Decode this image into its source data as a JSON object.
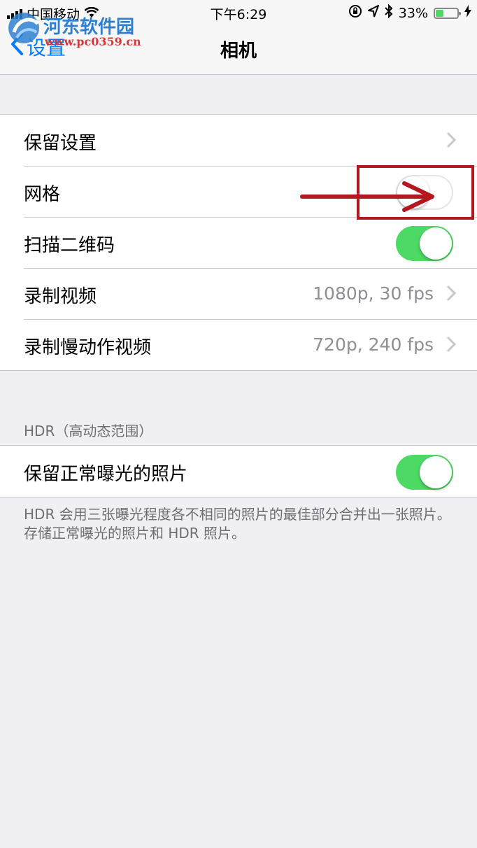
{
  "status_bar": {
    "carrier": "中国移动",
    "time": "下午6:29",
    "battery_percent": "33%",
    "battery_level": 0.33
  },
  "watermark": {
    "title": "河东软件园",
    "url": "www.pc0359.cn"
  },
  "nav": {
    "back_label": "设置",
    "title": "相机"
  },
  "settings": {
    "rows": [
      {
        "label": "保留设置",
        "control": "chevron"
      },
      {
        "label": "网格",
        "control": "toggle",
        "on": false
      },
      {
        "label": "扫描二维码",
        "control": "toggle",
        "on": true
      },
      {
        "label": "录制视频",
        "value": "1080p, 30 fps",
        "control": "chevron"
      },
      {
        "label": "录制慢动作视频",
        "value": "720p, 240 fps",
        "control": "chevron"
      }
    ]
  },
  "hdr": {
    "header": "HDR（高动态范围）",
    "row": {
      "label": "保留正常曝光的照片",
      "on": true
    },
    "footer": "HDR 会用三张曝光程度各不相同的照片的最佳部分合并出一张照片。存储正常曝光的照片和 HDR 照片。"
  },
  "colors": {
    "accent": "#007aff",
    "toggle_on": "#4cd964",
    "annotation": "#b3181e"
  }
}
